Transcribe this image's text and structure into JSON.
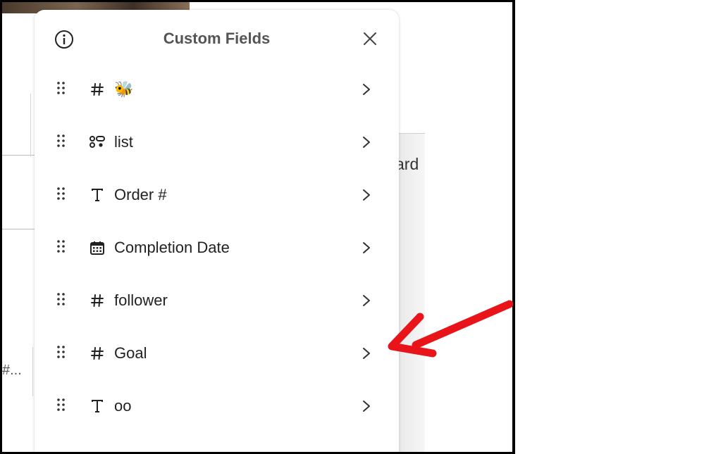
{
  "panel": {
    "title": "Custom Fields"
  },
  "fields": [
    {
      "type_icon": "hash-icon",
      "name": "🐝"
    },
    {
      "type_icon": "list-icon",
      "name": "list"
    },
    {
      "type_icon": "text-icon",
      "name": "Order #"
    },
    {
      "type_icon": "calendar-icon",
      "name": "Completion Date"
    },
    {
      "type_icon": "hash-icon",
      "name": "follower"
    },
    {
      "type_icon": "hash-icon",
      "name": "Goal"
    },
    {
      "type_icon": "text-icon",
      "name": "oo"
    }
  ],
  "background": {
    "partial_text": "ard",
    "partial_text_2": "#..."
  },
  "colors": {
    "annotation_arrow": "#e8141a",
    "title_text": "#555555"
  }
}
